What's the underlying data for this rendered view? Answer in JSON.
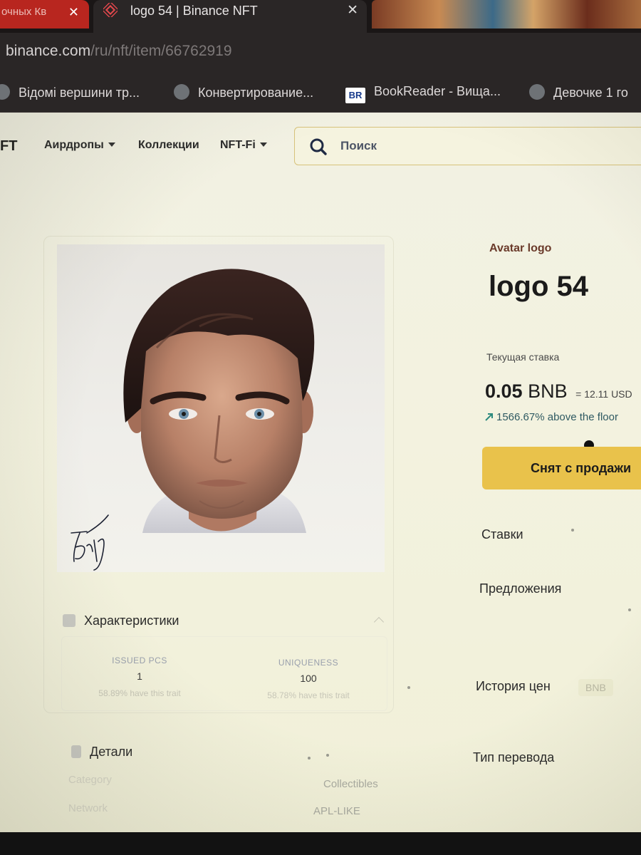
{
  "browser": {
    "prev_tab_title": "очных Кв",
    "active_tab_title": "logo 54 | Binance NFT",
    "tab_close_glyph": "✕",
    "url_host": "binance.com",
    "url_path": "/ru/nft/item/66762919",
    "bookmarks": [
      "Відомі вершини тр...",
      "Конвертирование...",
      "BookReader - Вища...",
      "Девочке 1 го"
    ],
    "bookreader_icon_text": "BR"
  },
  "nav": {
    "brand": "FT",
    "items": [
      "Аирдропы",
      "Коллекции",
      "NFT-Fi"
    ],
    "search_placeholder": "Поиск"
  },
  "item": {
    "collection": "Avatar logo",
    "title": "logo 54",
    "bid_label": "Текущая ставка",
    "price_value": "0.05",
    "price_currency": "BNB",
    "price_usd": "= 12.11 USD",
    "floor_text": "1566.67% above the floor",
    "delist_button": "Снят с продажи"
  },
  "sections": {
    "bids": "Ставки",
    "offers": "Предложения",
    "price_history": "История цен",
    "price_history_badge": "BNB",
    "transfer_type": "Тип перевода"
  },
  "traits": {
    "heading": "Характеристики",
    "items": [
      {
        "key": "ISSUED PCS",
        "value": "1",
        "rarity": "58.89% have this trait"
      },
      {
        "key": "UNIQUENESS",
        "value": "100",
        "rarity": "58.78% have this trait"
      }
    ]
  },
  "details": {
    "heading": "Детали",
    "rows": [
      {
        "label": "Category",
        "value": "Collectibles"
      },
      {
        "label": "Network",
        "value": "APL-LIKE"
      }
    ]
  },
  "colors": {
    "accent_yellow": "#E9C24B",
    "positive_green": "#2C8A7E",
    "tab_red": "#B8261F"
  },
  "icons": [
    "binance-logo-icon",
    "search-icon",
    "caret-down-icon",
    "trending-up-icon",
    "close-icon",
    "globe-icon",
    "traits-icon",
    "details-icon",
    "chevron-up-icon"
  ]
}
